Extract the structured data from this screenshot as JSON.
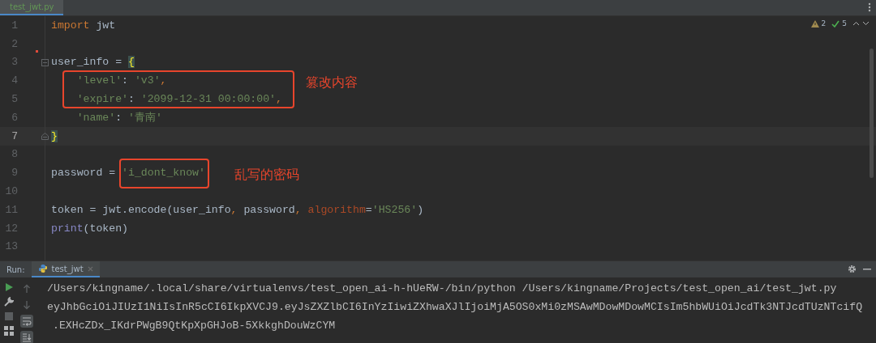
{
  "tabs": [
    {
      "label": "test_jwt.py",
      "selected": true
    }
  ],
  "inspections": {
    "warnings": "2",
    "weak_warnings": "5"
  },
  "code_lines": [
    {
      "number": "1",
      "current": false,
      "tokens": [
        {
          "kind": "kw",
          "text": "import"
        },
        {
          "kind": "plain",
          "text": " jwt"
        }
      ]
    },
    {
      "number": "2",
      "current": false
    },
    {
      "number": "3",
      "current": false,
      "tokens": [
        {
          "kind": "plain",
          "text": "user_info = "
        },
        {
          "kind": "brace",
          "text": "{"
        }
      ]
    },
    {
      "number": "4",
      "current": false,
      "tokens": [
        {
          "kind": "str",
          "text": "    'level'"
        },
        {
          "kind": "plain",
          "text": ": "
        },
        {
          "kind": "str",
          "text": "'v3'"
        },
        {
          "kind": "punc",
          "text": ","
        }
      ]
    },
    {
      "number": "5",
      "current": false,
      "tokens": [
        {
          "kind": "str",
          "text": "    'expire'"
        },
        {
          "kind": "plain",
          "text": ": "
        },
        {
          "kind": "str",
          "text": "'2099-12-31 00:00:00'"
        },
        {
          "kind": "punc",
          "text": ","
        }
      ]
    },
    {
      "number": "6",
      "current": false,
      "tokens": [
        {
          "kind": "str",
          "text": "    'name'"
        },
        {
          "kind": "plain",
          "text": ": "
        },
        {
          "kind": "str",
          "text": "'青南'"
        }
      ]
    },
    {
      "number": "7",
      "current": true,
      "tokens": [
        {
          "kind": "brace",
          "text": "}"
        }
      ]
    },
    {
      "number": "8",
      "current": false
    },
    {
      "number": "9",
      "current": false,
      "tokens": [
        {
          "kind": "plain",
          "text": "password = "
        },
        {
          "kind": "str",
          "text": "'i_dont_know'"
        }
      ]
    },
    {
      "number": "10",
      "current": false
    },
    {
      "number": "11",
      "current": false,
      "tokens": [
        {
          "kind": "plain",
          "text": "token = jwt.encode(user_info"
        },
        {
          "kind": "punc",
          "text": ","
        },
        {
          "kind": "plain",
          "text": " password"
        },
        {
          "kind": "punc",
          "text": ","
        },
        {
          "kind": "param",
          "text": " algorithm"
        },
        {
          "kind": "plain",
          "text": "="
        },
        {
          "kind": "str",
          "text": "'HS256'"
        },
        {
          "kind": "plain",
          "text": ")"
        }
      ]
    },
    {
      "number": "12",
      "current": false,
      "tokens": [
        {
          "kind": "builtin",
          "text": "print"
        },
        {
          "kind": "plain",
          "text": "(token)"
        }
      ]
    },
    {
      "number": "13",
      "current": false
    }
  ],
  "annotations": [
    {
      "label": "篡改内容"
    },
    {
      "label": "乱写的密码"
    }
  ],
  "run_panel": {
    "label": "Run:",
    "tabs": [
      {
        "label": "test_jwt",
        "selected": true
      }
    ],
    "output": [
      {
        "text": "/Users/kingname/.local/share/virtualenvs/test_open_ai-h-hUeRW-/bin/python /Users/kingname/Projects/test_open_ai/test_jwt.py",
        "wrapped": false
      },
      {
        "text": "eyJhbGciOiJIUzI1NiIsInR5cCI6IkpXVCJ9.eyJsZXZlbCI6InYzIiwiZXhwaXJlIjoiMjA5OS0xMi0zMSAwMDowMDowMCIsIm5hbWUiOiJcdTk3NTJcdTUzNTcifQ",
        "wrapped": false
      },
      {
        "text": ".EXHcZDx_IKdrPWgB9QtKpXpGHJoB-5XkkghDouWzCYM",
        "wrapped": true
      }
    ]
  }
}
